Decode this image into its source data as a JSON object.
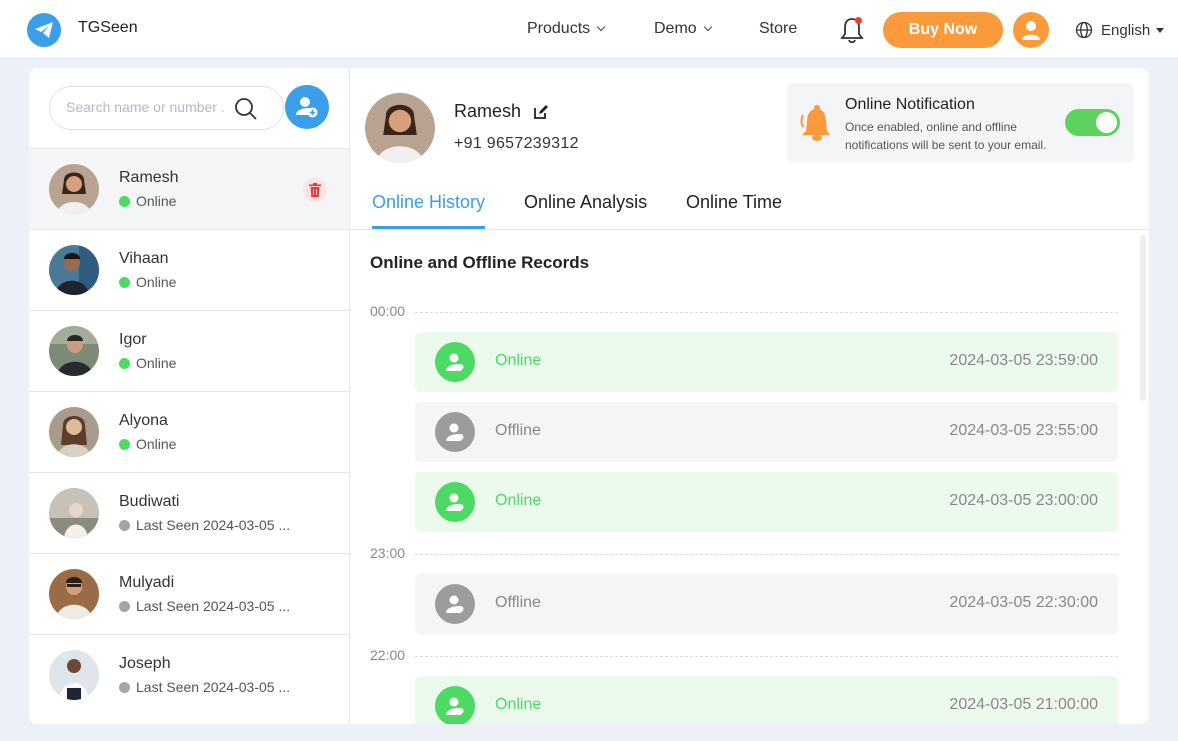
{
  "nav": {
    "brand": "TGSeen",
    "products": "Products",
    "demo": "Demo",
    "store": "Store",
    "buy_now": "Buy Now",
    "language": "English"
  },
  "sidebar": {
    "search_placeholder": "Search name or number ...",
    "contacts": [
      {
        "name": "Ramesh",
        "status": "Online",
        "online": true
      },
      {
        "name": "Vihaan",
        "status": "Online",
        "online": true
      },
      {
        "name": "Igor",
        "status": "Online",
        "online": true
      },
      {
        "name": "Alyona",
        "status": "Online",
        "online": true
      },
      {
        "name": "Budiwati",
        "status": "Last Seen 2024-03-05 ...",
        "online": false
      },
      {
        "name": "Mulyadi",
        "status": "Last Seen 2024-03-05 ...",
        "online": false
      },
      {
        "name": "Joseph",
        "status": "Last Seen 2024-03-05 ...",
        "online": false
      }
    ]
  },
  "profile": {
    "name": "Ramesh",
    "phone": "+91 9657239312"
  },
  "notification": {
    "title": "Online Notification",
    "description": "Once enabled, online and offline notifications will be sent to your email.",
    "enabled": true
  },
  "tabs": [
    {
      "label": "Online History",
      "active": true
    },
    {
      "label": "Online Analysis",
      "active": false
    },
    {
      "label": "Online Time",
      "active": false
    }
  ],
  "records": {
    "title": "Online and Offline Records",
    "hours": [
      {
        "label": "00:00"
      },
      {
        "label": "23:00"
      },
      {
        "label": "22:00"
      }
    ],
    "items": [
      {
        "status": "Online",
        "time": "2024-03-05 23:59:00"
      },
      {
        "status": "Offline",
        "time": "2024-03-05 23:55:00"
      },
      {
        "status": "Online",
        "time": "2024-03-05 23:00:00"
      },
      {
        "status": "Offline",
        "time": "2024-03-05 22:30:00"
      },
      {
        "status": "Online",
        "time": "2024-03-05 21:00:00"
      }
    ]
  },
  "colors": {
    "accent": "#3a9ee8",
    "orange": "#fb9a3a",
    "online": "#4cd964",
    "offline": "#9c9c9c"
  }
}
